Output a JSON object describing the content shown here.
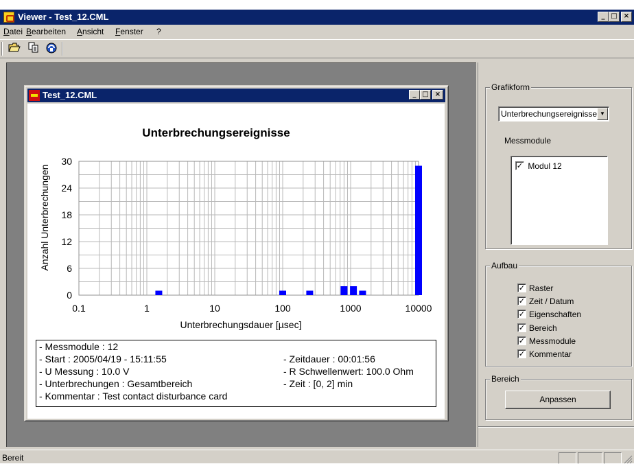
{
  "window": {
    "title": "Viewer - Test_12.CML"
  },
  "menu": [
    "Datei",
    "Bearbeiten",
    "Ansicht",
    "Fenster",
    "?"
  ],
  "toolbar": {
    "icons": [
      "open-folder-icon",
      "copy-icon",
      "network-icon"
    ]
  },
  "child_window": {
    "title": "Test_12.CML"
  },
  "chart_data": {
    "type": "bar",
    "title": "Unterbrechungsereignisse",
    "xlabel": "Unterbrechungsdauer [µsec]",
    "ylabel": "Anzahl Unterbrechungen",
    "x_scale": "log",
    "xlim": [
      0.1,
      10000
    ],
    "ylim": [
      0,
      30
    ],
    "x_ticks": [
      "0.1",
      "1",
      "10",
      "100",
      "1000",
      "10000"
    ],
    "y_ticks": [
      "0",
      "6",
      "12",
      "18",
      "24",
      "30"
    ],
    "grid": true,
    "bar_color": "#0000ff",
    "bars": [
      {
        "x": 1.5,
        "value": 1
      },
      {
        "x": 100,
        "value": 1
      },
      {
        "x": 250,
        "value": 1
      },
      {
        "x": 800,
        "value": 2
      },
      {
        "x": 1100,
        "value": 2
      },
      {
        "x": 1500,
        "value": 1
      },
      {
        "x": 10000,
        "value": 29
      }
    ]
  },
  "info": {
    "left": [
      "- Messmodule : 12",
      "- Start : 2005/04/19 - 15:11:55",
      "- U Messung : 10.0 V",
      "- Unterbrechungen : Gesamtbereich",
      "- Kommentar : Test contact disturbance card"
    ],
    "right": [
      "- Zeitdauer : 00:01:56",
      "- R Schwellenwert: 100.0 Ohm",
      "- Zeit : [0, 2] min"
    ]
  },
  "panel": {
    "grafikform": {
      "title": "Grafikform",
      "selected": "Unterbrechungsereignisse",
      "messmodule_label": "Messmodule",
      "modules": [
        {
          "label": "Modul 12",
          "checked": true
        }
      ]
    },
    "aufbau": {
      "title": "Aufbau",
      "options": [
        {
          "label": "Raster",
          "checked": true
        },
        {
          "label": "Zeit / Datum",
          "checked": true
        },
        {
          "label": "Eigenschaften",
          "checked": true
        },
        {
          "label": "Bereich",
          "checked": true
        },
        {
          "label": "Messmodule",
          "checked": true
        },
        {
          "label": "Kommentar",
          "checked": true
        }
      ]
    },
    "bereich": {
      "title": "Bereich",
      "button": "Anpassen"
    }
  },
  "status": {
    "text": "Bereit"
  }
}
